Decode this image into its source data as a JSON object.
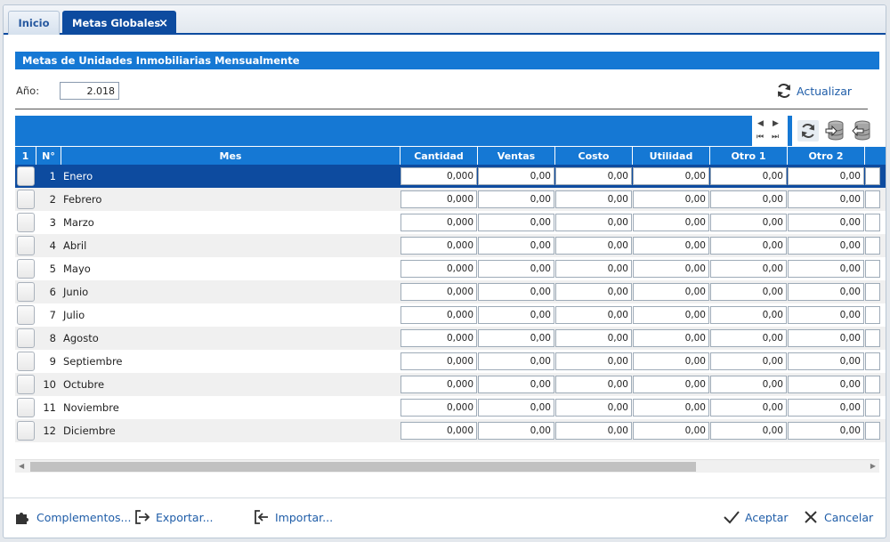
{
  "tabs": [
    {
      "label": "Inicio"
    },
    {
      "label": "Metas Globales",
      "close": "×"
    }
  ],
  "section_title": "Metas de Unidades Inmobiliarias Mensualmente",
  "anio": {
    "label": "Año:",
    "value": "2.018"
  },
  "actualizar_label": "Actualizar",
  "grid": {
    "headers": {
      "sel": "1",
      "n": "N°",
      "mes": "Mes",
      "cantidad": "Cantidad",
      "ventas": "Ventas",
      "costo": "Costo",
      "utilidad": "Utilidad",
      "otro1": "Otro 1",
      "otro2": "Otro 2"
    },
    "rows": [
      {
        "n": "1",
        "mes": "Enero",
        "cantidad": "0,000",
        "ventas": "0,00",
        "costo": "0,00",
        "utilidad": "0,00",
        "otro1": "0,00",
        "otro2": "0,00"
      },
      {
        "n": "2",
        "mes": "Febrero",
        "cantidad": "0,000",
        "ventas": "0,00",
        "costo": "0,00",
        "utilidad": "0,00",
        "otro1": "0,00",
        "otro2": "0,00"
      },
      {
        "n": "3",
        "mes": "Marzo",
        "cantidad": "0,000",
        "ventas": "0,00",
        "costo": "0,00",
        "utilidad": "0,00",
        "otro1": "0,00",
        "otro2": "0,00"
      },
      {
        "n": "4",
        "mes": "Abril",
        "cantidad": "0,000",
        "ventas": "0,00",
        "costo": "0,00",
        "utilidad": "0,00",
        "otro1": "0,00",
        "otro2": "0,00"
      },
      {
        "n": "5",
        "mes": "Mayo",
        "cantidad": "0,000",
        "ventas": "0,00",
        "costo": "0,00",
        "utilidad": "0,00",
        "otro1": "0,00",
        "otro2": "0,00"
      },
      {
        "n": "6",
        "mes": "Junio",
        "cantidad": "0,000",
        "ventas": "0,00",
        "costo": "0,00",
        "utilidad": "0,00",
        "otro1": "0,00",
        "otro2": "0,00"
      },
      {
        "n": "7",
        "mes": "Julio",
        "cantidad": "0,000",
        "ventas": "0,00",
        "costo": "0,00",
        "utilidad": "0,00",
        "otro1": "0,00",
        "otro2": "0,00"
      },
      {
        "n": "8",
        "mes": "Agosto",
        "cantidad": "0,000",
        "ventas": "0,00",
        "costo": "0,00",
        "utilidad": "0,00",
        "otro1": "0,00",
        "otro2": "0,00"
      },
      {
        "n": "9",
        "mes": "Septiembre",
        "cantidad": "0,000",
        "ventas": "0,00",
        "costo": "0,00",
        "utilidad": "0,00",
        "otro1": "0,00",
        "otro2": "0,00"
      },
      {
        "n": "10",
        "mes": "Octubre",
        "cantidad": "0,000",
        "ventas": "0,00",
        "costo": "0,00",
        "utilidad": "0,00",
        "otro1": "0,00",
        "otro2": "0,00"
      },
      {
        "n": "11",
        "mes": "Noviembre",
        "cantidad": "0,000",
        "ventas": "0,00",
        "costo": "0,00",
        "utilidad": "0,00",
        "otro1": "0,00",
        "otro2": "0,00"
      },
      {
        "n": "12",
        "mes": "Diciembre",
        "cantidad": "0,000",
        "ventas": "0,00",
        "costo": "0,00",
        "utilidad": "0,00",
        "otro1": "0,00",
        "otro2": "0,00"
      }
    ]
  },
  "toolbar_icons": [
    "nav-arrows-icon",
    "refresh-icon",
    "database-export-icon",
    "database-import-icon"
  ],
  "footer": {
    "complementos": "Complementos...",
    "exportar": "Exportar...",
    "importar": "Importar...",
    "aceptar": "Aceptar",
    "cancelar": "Cancelar"
  },
  "colors": {
    "accent": "#1578d4",
    "selected": "#0d4b9f",
    "link": "#1f5da8"
  }
}
